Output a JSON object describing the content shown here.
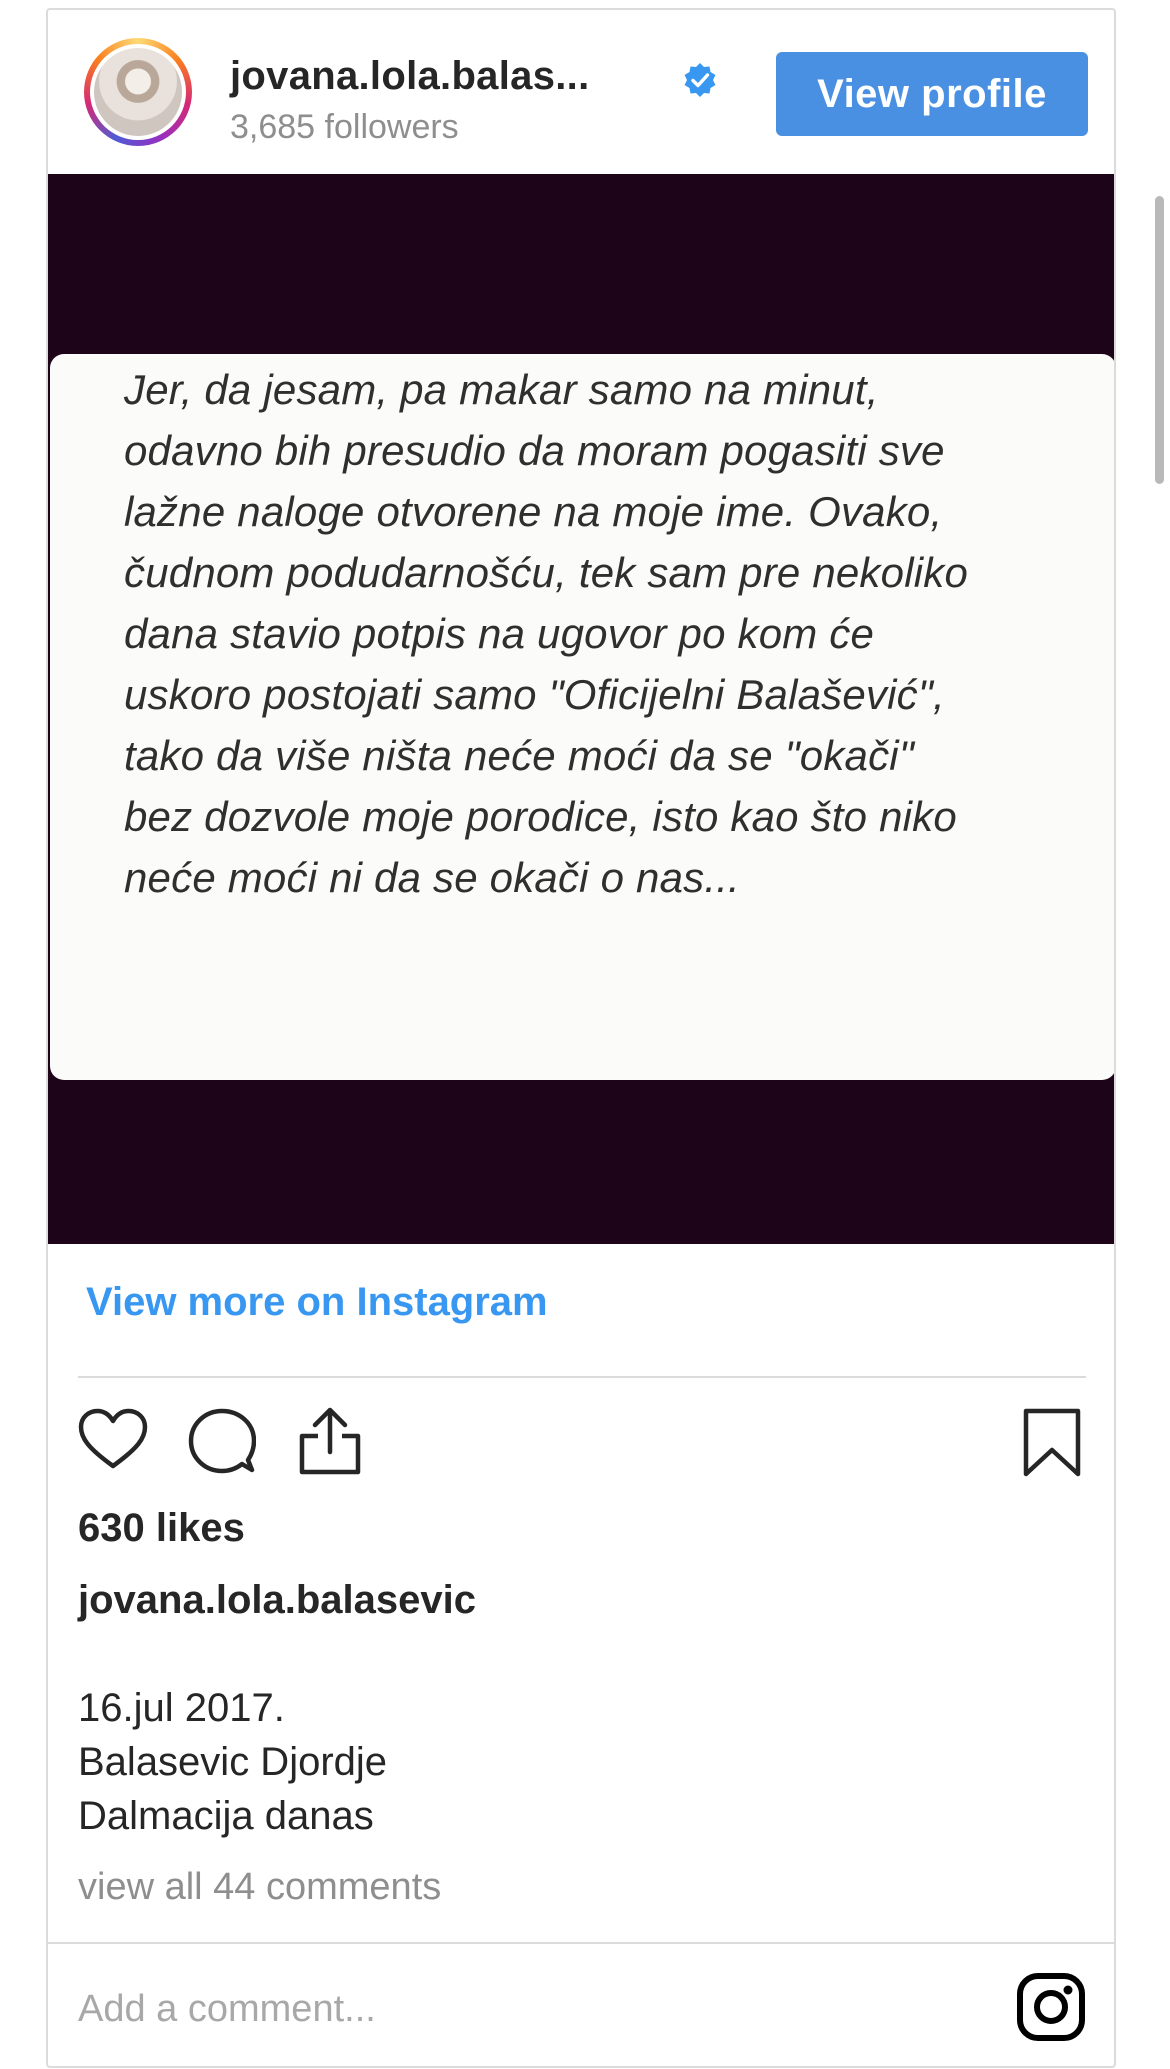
{
  "header": {
    "username": "jovana.lola.balas...",
    "followers": "3,685 followers",
    "view_profile_label": "View profile"
  },
  "media": {
    "quote_lines": [
      "Jer, da jesam, pa makar samo na minut,",
      "odavno bih presudio da moram pogasiti sve",
      "lažne naloge otvorene na moje ime. Ovako,",
      "čudnom podudarnošću, tek sam pre nekoliko",
      "dana stavio potpis na ugovor po kom će",
      "uskoro postojati samo \"Oficijelni Balašević\",",
      "tako da više ništa neće moći da se \"okači\"",
      "bez dozvole moje porodice, isto kao što niko",
      "neće moći ni da se okači o nas..."
    ]
  },
  "view_more_label": "View more on Instagram",
  "actions": {
    "icons": [
      "heart-icon",
      "comment-icon",
      "share-icon",
      "bookmark-icon"
    ]
  },
  "likes": "630 likes",
  "caption": {
    "username": "jovana.lola.balasevic",
    "lines": [
      "16.jul 2017.",
      "Balasevic Djordje",
      "Dalmacija danas"
    ]
  },
  "comments_link": "view all 44 comments",
  "add_comment_placeholder": "Add a comment...",
  "colors": {
    "accent": "#4a90e2",
    "link": "#3897f0",
    "media_bg": "#1d0419"
  }
}
